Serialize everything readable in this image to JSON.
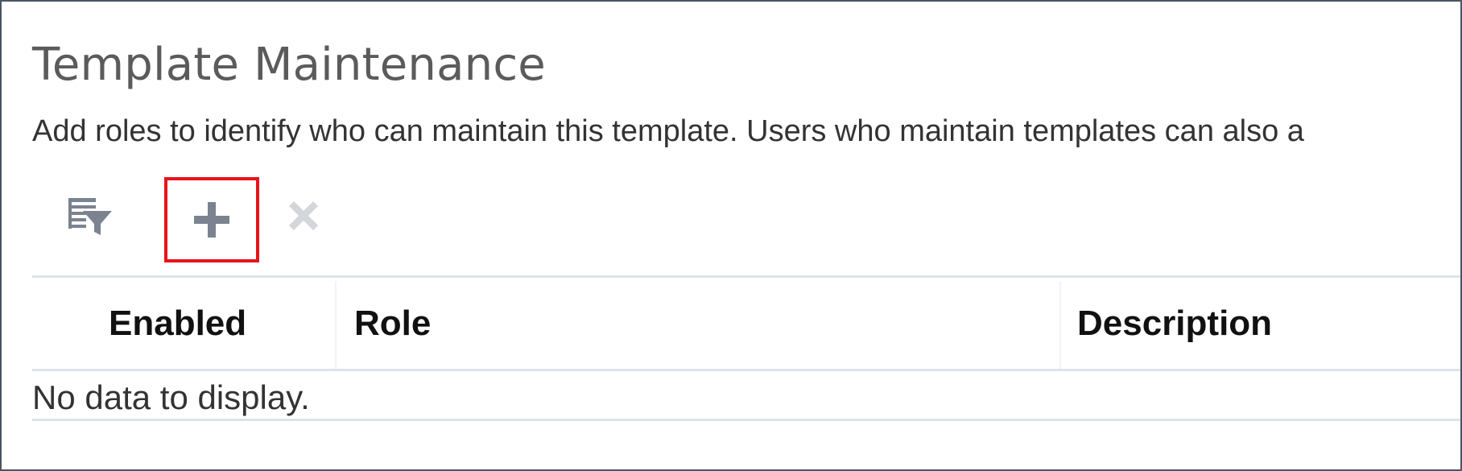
{
  "page": {
    "title": "Template Maintenance",
    "instructions": "Add roles to identify who can maintain this template. Users who maintain templates can also a"
  },
  "toolbar": {
    "buttons": [
      {
        "icon": "query-by-example-icon",
        "enabled": true
      },
      {
        "icon": "add-icon",
        "enabled": true,
        "highlighted": true
      },
      {
        "icon": "delete-icon",
        "enabled": false
      }
    ]
  },
  "table": {
    "columns": [
      "Enabled",
      "Role",
      "Description"
    ],
    "rows": [],
    "empty_message": "No data to display."
  },
  "colors": {
    "highlight_border": "#e8141a",
    "enabled_icon": "#7b8390",
    "disabled_icon": "#d3d6da",
    "divider": "#dde3ea"
  }
}
